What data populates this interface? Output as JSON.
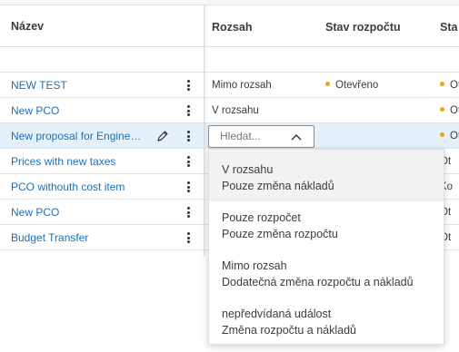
{
  "columns": {
    "name": "Název",
    "scope": "Rozsah",
    "budget_status": "Stav rozpočtu",
    "status": "Sta"
  },
  "rows": [
    {
      "name": "NEW TEST",
      "scope": "Mimo rozsah",
      "budget_status": "Otevřeno",
      "status": "Ot"
    },
    {
      "name": "New PCO",
      "scope": "V rozsahu",
      "budget_status": "",
      "status": "Ot"
    },
    {
      "name": "New proposal for Engineering",
      "scope": "",
      "budget_status": "",
      "status": "Ot"
    },
    {
      "name": "Prices with new taxes",
      "scope": "",
      "budget_status": "",
      "status": "Ot"
    },
    {
      "name": "PCO withouth cost item",
      "scope": "",
      "budget_status": "",
      "status": "Ko"
    },
    {
      "name": "New PCO",
      "scope": "",
      "budget_status": "",
      "status": "Ot"
    },
    {
      "name": "Budget Transfer",
      "scope": "",
      "budget_status": "",
      "status": "Ot"
    }
  ],
  "search": {
    "placeholder": "Hledat..."
  },
  "dropdown_options": [
    {
      "title": "V rozsahu",
      "subtitle": "Pouze změna nákladů"
    },
    {
      "title": "Pouze rozpočet",
      "subtitle": "Pouze změna rozpočtu"
    },
    {
      "title": "Mimo rozsah",
      "subtitle": "Dodatečná změna rozpočtu a nákladů"
    },
    {
      "title": "nepředvídaná událost",
      "subtitle": "Změna rozpočtu a nákladů"
    }
  ],
  "colors": {
    "link": "#1f6fb5",
    "status_dot": "#f0a020",
    "selected_row": "#e4f1fb"
  },
  "icons": {
    "edit": "pencil-icon",
    "menu": "more-vertical-icon",
    "dropdown": "chevron-up-icon"
  }
}
